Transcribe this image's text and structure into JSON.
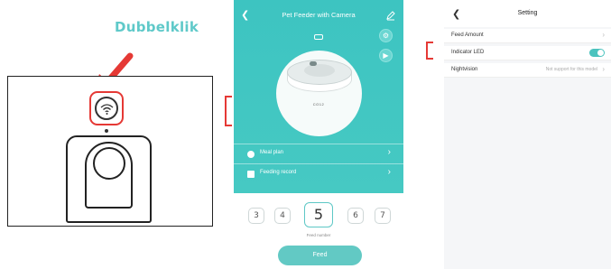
{
  "instruction": {
    "caption": "Dubbelklik"
  },
  "feeder_app": {
    "title": "Pet Feeder with Camera",
    "back_icon": "chevron-left-icon",
    "edit_icon": "pencil-icon",
    "device_model_label": "CO12",
    "menu": [
      {
        "label": "Meal plan",
        "icon": "clock-icon"
      },
      {
        "label": "Feeding record",
        "icon": "list-icon"
      }
    ],
    "feed_numbers": [
      "3",
      "4",
      "5",
      "6",
      "7"
    ],
    "selected_feed_number": "5",
    "feed_number_label": "Feed number",
    "feed_button": "Feed",
    "accent_color": "#3dc4c1"
  },
  "settings_app": {
    "title": "Setting",
    "rows": [
      {
        "label": "Feed Amount",
        "value": "",
        "control": "chevron"
      },
      {
        "label": "Indicator LED",
        "value": "",
        "control": "toggle",
        "on": true
      },
      {
        "label": "Nightvision",
        "value": "Not support for this model",
        "control": "chevron"
      }
    ]
  }
}
